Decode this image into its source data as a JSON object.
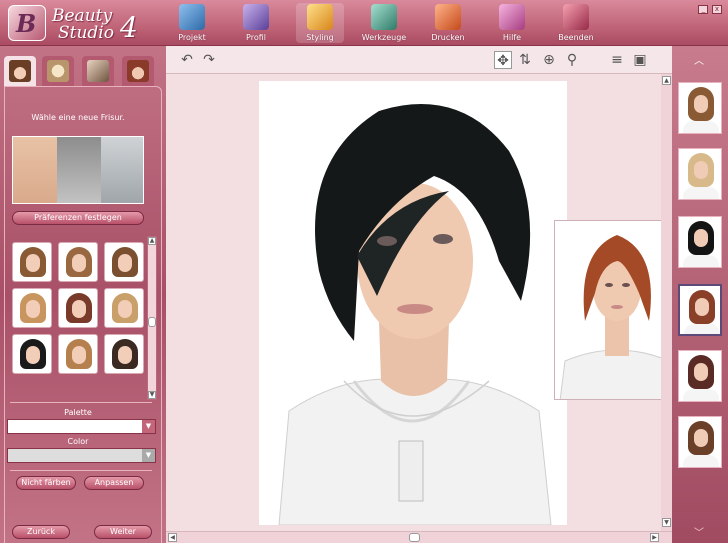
{
  "app": {
    "name_line1": "Beauty",
    "name_line2": "Studio",
    "version": "4"
  },
  "menu": [
    {
      "id": "projekt",
      "label": "Projekt",
      "icon": "folder-icon",
      "color": "#4a7fb8"
    },
    {
      "id": "profil",
      "label": "Profil",
      "icon": "profile-icon",
      "color": "#7c5fb0"
    },
    {
      "id": "styling",
      "label": "Styling",
      "icon": "styling-icon",
      "color": "#e2a12c",
      "active": true
    },
    {
      "id": "werkzeuge",
      "label": "Werkzeuge",
      "icon": "tools-icon",
      "color": "#3f8a7a"
    },
    {
      "id": "drucken",
      "label": "Drucken",
      "icon": "print-icon",
      "color": "#d45a2a"
    },
    {
      "id": "hilfe",
      "label": "Hilfe",
      "icon": "help-icon",
      "color": "#c05a9a"
    },
    {
      "id": "beenden",
      "label": "Beenden",
      "icon": "exit-icon",
      "color": "#b8405a"
    }
  ],
  "window": {
    "minimize": "_",
    "close": "x"
  },
  "left_panel": {
    "prompt": "Wähle eine neue Frisur.",
    "preferences_button": "Präferenzen festlegen",
    "palette_label": "Palette",
    "color_label": "Color",
    "no_color_button": "Nicht färben",
    "adjust_button": "Anpassen",
    "back_button": "Zurück",
    "next_button": "Weiter"
  },
  "hair_colors": [
    "#8a5a35",
    "#9a6840",
    "#7a5030",
    "#c8955e",
    "#7a3a2a",
    "#c9a06a",
    "#1a1a1a",
    "#b5804e",
    "#3a2a22"
  ],
  "rail_thumbs": [
    {
      "hair": "#8a5a35"
    },
    {
      "hair": "#d8b98a"
    },
    {
      "hair": "#141414"
    },
    {
      "hair": "#8a4028",
      "selected": true
    },
    {
      "hair": "#5a2a25"
    },
    {
      "hair": "#6a4028"
    }
  ]
}
